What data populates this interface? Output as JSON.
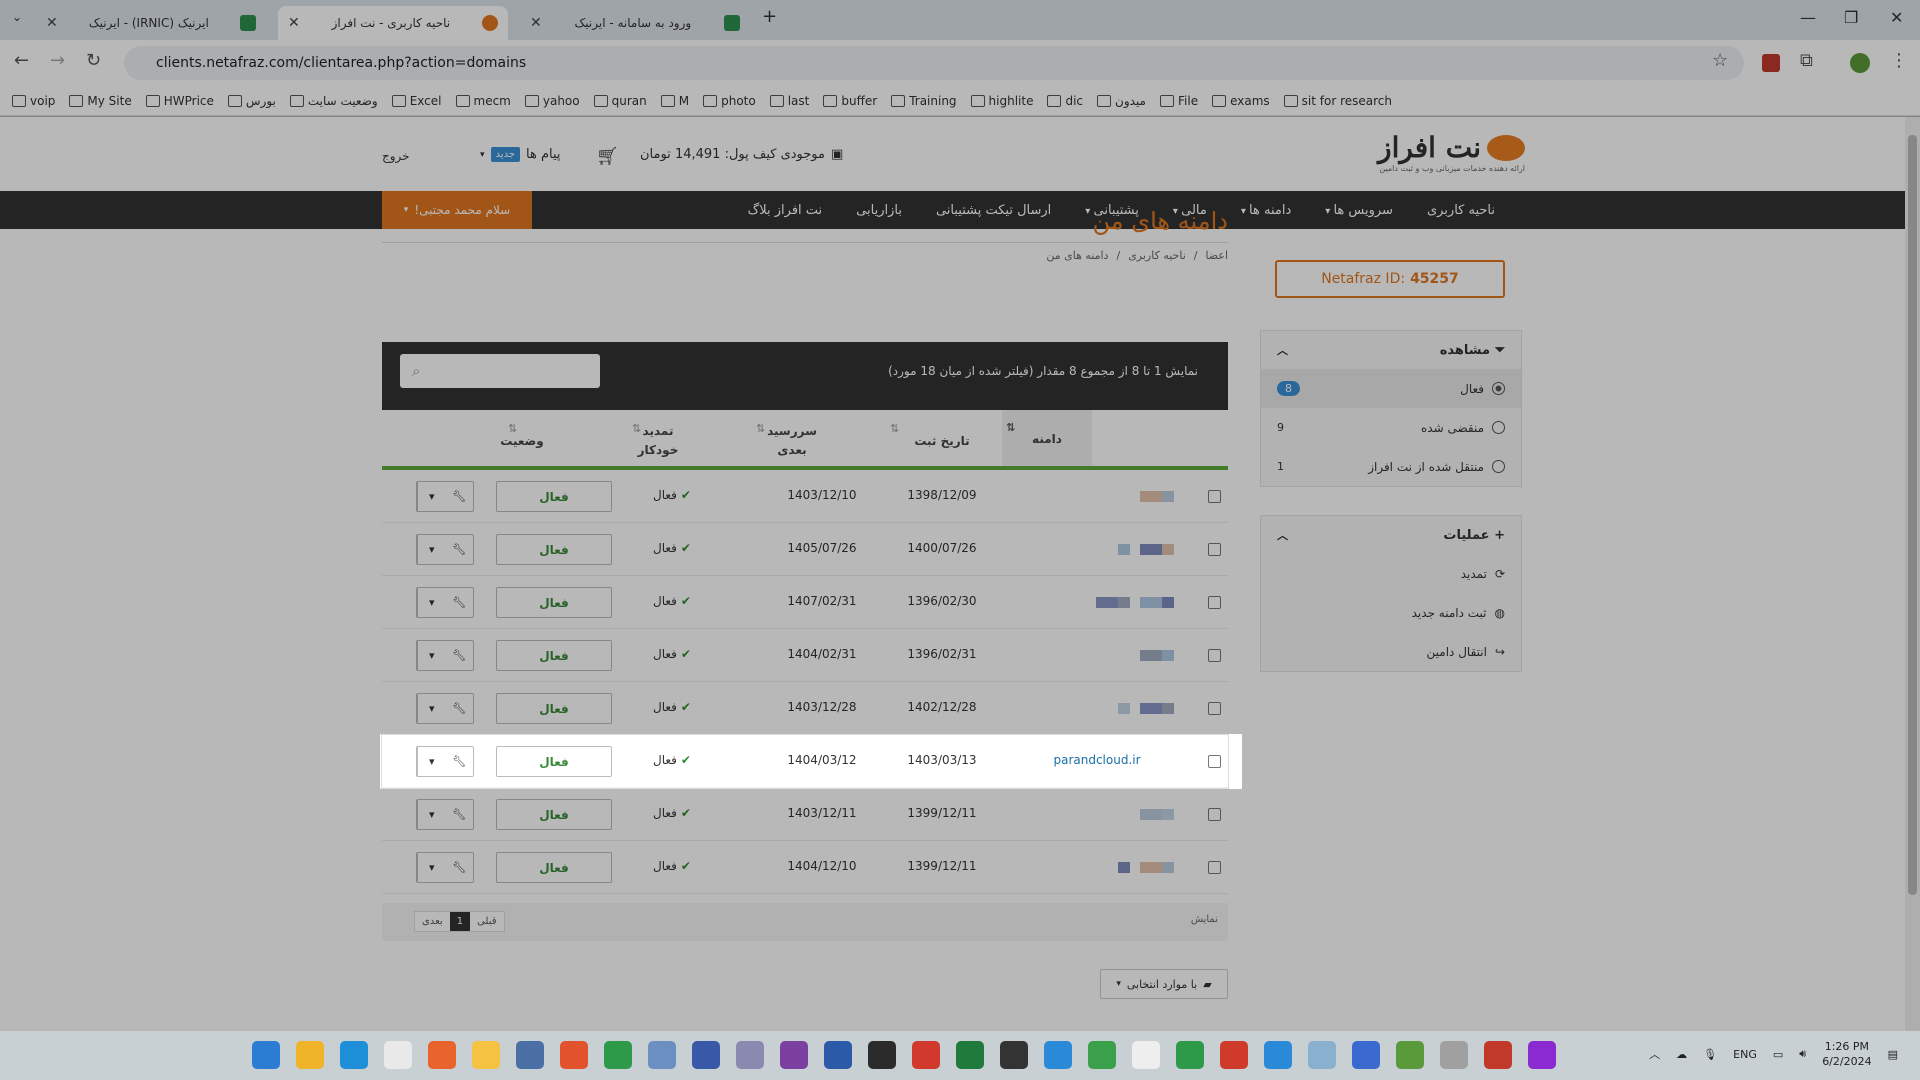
{
  "browser": {
    "tabs": [
      {
        "title": "ایرنیک (IRNIC) - ایرنیک",
        "active": false
      },
      {
        "title": "ناحیه کاربری - نت افراز",
        "active": true
      },
      {
        "title": "ورود به سامانه - ایرنیک",
        "active": false
      }
    ],
    "new_tab": "+",
    "url": "clients.netafraz.com/clientarea.php?action=domains",
    "bookmarks": [
      "voip",
      "My Site",
      "HWPrice",
      "بورس",
      "وضعیت سایت",
      "Excel",
      "mecm",
      "yahoo",
      "quran",
      "M",
      "photo",
      "last",
      "buffer",
      "Training",
      "highlite",
      "dic",
      "میدون",
      "File",
      "exams",
      "sit for research"
    ]
  },
  "header": {
    "brand": "نت افراز",
    "tagline": "ارائه دهنده خدمات میزبانی وب و ثبت دامین",
    "wallet": "موجودی کیف پول: 14,491 تومان",
    "messages": "پیام ها",
    "new_badge": "جدید",
    "logout": "خروج"
  },
  "nav": {
    "items": [
      {
        "label": "ناحیه کاربری",
        "dropdown": false
      },
      {
        "label": "سرویس ها",
        "dropdown": true
      },
      {
        "label": "دامنه ها",
        "dropdown": true
      },
      {
        "label": "مالی",
        "dropdown": true
      },
      {
        "label": "پشتیبانی",
        "dropdown": true
      },
      {
        "label": "ارسال تیکت پشتیبانی",
        "dropdown": false
      },
      {
        "label": "بازاریابی",
        "dropdown": false
      },
      {
        "label": "نت افراز بلاگ",
        "dropdown": false
      }
    ],
    "greeting": "سلام محمد مجتبی!"
  },
  "sidebar": {
    "netid_label": "Netafraz ID:",
    "netid_value": "45257",
    "view": {
      "title": "مشاهده",
      "items": [
        {
          "label": "فعال",
          "count": "8",
          "selected": true
        },
        {
          "label": "منقضی شده",
          "count": "9",
          "selected": false
        },
        {
          "label": "منتقل شده از نت افراز",
          "count": "1",
          "selected": false
        }
      ]
    },
    "actions": {
      "title": "عملیات",
      "items": [
        "تمدید",
        "ثبت دامنه جدید",
        "انتقال دامین"
      ]
    }
  },
  "main": {
    "title": "دامنه های من",
    "breadcrumb": [
      "اعضا",
      "ناحیه کاربری",
      "دامنه های من"
    ],
    "table_info": "نمایش 1 تا 8 از مجموع 8 مقدار (فیلتر شده از میان 18 مورد)",
    "columns": {
      "domain": "دامنه",
      "reg_date": "تاریخ ثبت",
      "next_due": "سررسید بعدی",
      "auto_renew": "تمدید خودکار",
      "status": "وضعیت"
    },
    "rows": [
      {
        "domain": "",
        "reg": "1398/12/09",
        "due": "1403/12/10",
        "auto": "فعال",
        "status": "فعال",
        "highlight": false
      },
      {
        "domain": "",
        "reg": "1400/07/26",
        "due": "1405/07/26",
        "auto": "فعال",
        "status": "فعال",
        "highlight": false
      },
      {
        "domain": "",
        "reg": "1396/02/30",
        "due": "1407/02/31",
        "auto": "فعال",
        "status": "فعال",
        "highlight": false
      },
      {
        "domain": "",
        "reg": "1396/02/31",
        "due": "1404/02/31",
        "auto": "فعال",
        "status": "فعال",
        "highlight": false
      },
      {
        "domain": "",
        "reg": "1402/12/28",
        "due": "1403/12/28",
        "auto": "فعال",
        "status": "فعال",
        "highlight": false
      },
      {
        "domain": "parandcloud.ir",
        "reg": "1403/03/13",
        "due": "1404/03/12",
        "auto": "فعال",
        "status": "فعال",
        "highlight": true
      },
      {
        "domain": "",
        "reg": "1399/12/11",
        "due": "1403/12/11",
        "auto": "فعال",
        "status": "فعال",
        "highlight": false
      },
      {
        "domain": "",
        "reg": "1399/12/11",
        "due": "1404/12/10",
        "auto": "فعال",
        "status": "فعال",
        "highlight": false
      }
    ],
    "pager": {
      "prev": "قبلی",
      "current": "1",
      "next": "بعدی"
    },
    "show_label": "نمایش",
    "bulk_label": "با موارد انتخابی"
  },
  "taskbar": {
    "lang": "ENG",
    "time": "1:26 PM",
    "date": "6/2/2024"
  },
  "colors": {
    "accent": "#e07820",
    "nav_bg": "#333333",
    "status_green": "#3a8a3a",
    "link": "#1a6fa6"
  }
}
